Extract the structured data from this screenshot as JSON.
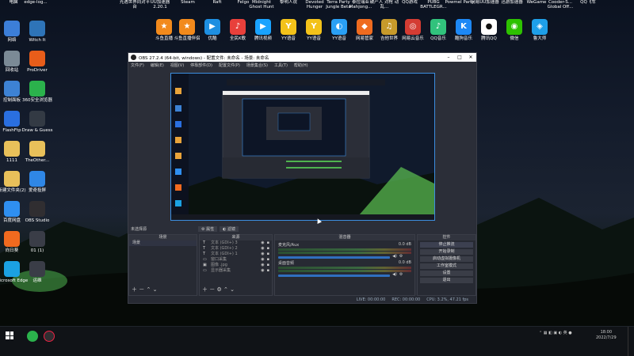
{
  "desktop": {
    "top_labels": [
      "电脑",
      "edge-log...",
      "光遇世界同对平台",
      "UU加速器 2.20.1",
      "Steam",
      "Raft",
      "Felgo",
      "Midnight Ghost Hunt",
      "黎明人说",
      "Devoted Hunger",
      "Terra Party Jungle Beta",
      "泰拉瑞亚 Mahjong...",
      "破产人 对枪 动乱...",
      "QQ游戏",
      "PUBG BATTLEGR...",
      "Powmel Party",
      "网易UU加速器",
      "迅游加速器",
      "WeGame",
      "Cooder-S... Global Off...",
      "QQ飞车"
    ],
    "app_icons": [
      {
        "label": "斗鱼直播",
        "color": "#f28a1c",
        "glyph": "★"
      },
      {
        "label": "斗鱼直播伴侣",
        "color": "#f28a1c",
        "glyph": "★"
      },
      {
        "label": "优酷",
        "color": "#1e8fe1",
        "glyph": "▶"
      },
      {
        "label": "全民K歌",
        "color": "#e8403b",
        "glyph": "♪"
      },
      {
        "label": "腾讯视频",
        "color": "#19a3ff",
        "glyph": "▶"
      },
      {
        "label": "YY语音",
        "color": "#f3c21a",
        "glyph": "Y"
      },
      {
        "label": "YY语音",
        "color": "#f3c21a",
        "glyph": "Y"
      },
      {
        "label": "YY语音",
        "color": "#2aa0f5",
        "glyph": "◐"
      },
      {
        "label": "网易管家",
        "color": "#ef6b1f",
        "glyph": "◆"
      },
      {
        "label": "吉他世界",
        "color": "#c79a2b",
        "glyph": "♫"
      },
      {
        "label": "网易云音乐",
        "color": "#d43c33",
        "glyph": "◎"
      },
      {
        "label": "QQ音乐",
        "color": "#31c27c",
        "glyph": "♪"
      },
      {
        "label": "酷狗音乐",
        "color": "#1d88f5",
        "glyph": "K"
      },
      {
        "label": "腾讯QQ",
        "color": "#ffffff",
        "glyph": "●"
      },
      {
        "label": "微信",
        "color": "#2dc100",
        "glyph": "◉"
      },
      {
        "label": "鲁大师",
        "color": "#1e9fe8",
        "glyph": "◈"
      }
    ],
    "left_icons": [
      {
        "label": "网络",
        "color": "#3c7ed8"
      },
      {
        "label": "Witch It",
        "color": "#2e74b8"
      },
      {
        "label": "回收站",
        "color": "#7b8a96"
      },
      {
        "label": "ProDriver",
        "color": "#e85d1a"
      },
      {
        "label": "控制面板",
        "color": "#3d82d4"
      },
      {
        "label": "360安全浏览器",
        "color": "#2bb24c"
      },
      {
        "label": "FlashFtp",
        "color": "#2a6fe0"
      },
      {
        "label": "Draw & Guess",
        "color": "#333a44"
      },
      {
        "label": "1111",
        "color": "#e8c05a"
      },
      {
        "label": "TheOther...",
        "color": "#e8c05a"
      },
      {
        "label": "新建文件夹(2)",
        "color": "#e8c05a"
      },
      {
        "label": "爱奇投屏",
        "color": "#2f87e6"
      },
      {
        "label": "百度网盘",
        "color": "#2f8ff0"
      },
      {
        "label": "OBS Studio",
        "color": "#302e31"
      },
      {
        "label": "向日葵",
        "color": "#f06a1f"
      },
      {
        "label": "01 (1)",
        "color": "#3a3d47"
      },
      {
        "label": "Microsoft Edge",
        "color": "#1ba1e2"
      },
      {
        "label": "运维",
        "color": "#3a3d47"
      }
    ]
  },
  "obs": {
    "title": "OBS 27.2.4 (64-bit, windows) - 配置文件: 未命名 - 场景: 未命名",
    "menu": [
      "文件(F)",
      "编辑(E)",
      "视图(V)",
      "停靠部件(D)",
      "配置文件(P)",
      "场景集合(S)",
      "工具(T)",
      "帮助(H)"
    ],
    "source_bar_label": "未选择源",
    "props_label": "属性",
    "filters_label": "滤镜",
    "scenes": {
      "header": "场景",
      "items": [
        "场景"
      ]
    },
    "sources": {
      "header": "来源",
      "items": [
        {
          "icon": "T",
          "name": "文本 (GDI+) 3"
        },
        {
          "icon": "T",
          "name": "文本 (GDI+) 2"
        },
        {
          "icon": "T",
          "name": "文本 (GDI+) 1"
        },
        {
          "icon": "▭",
          "name": "窗口采集"
        },
        {
          "icon": "▣",
          "name": "图像 .jpg"
        },
        {
          "icon": "▭",
          "name": "显示器采集"
        }
      ]
    },
    "mixer": {
      "header": "混音器",
      "tracks": [
        {
          "name": "麦克风/Aux",
          "db": "0.0 dB"
        },
        {
          "name": "桌面音频",
          "db": "0.0 dB"
        }
      ]
    },
    "controls": {
      "header": "控件",
      "buttons": [
        "停止推流",
        "开始录制",
        "启动虚拟摄像机",
        "工作室模式",
        "设置",
        "退出"
      ]
    },
    "status": {
      "live": "LIVE: 00:00:00",
      "rec": "REC: 00:00:00",
      "cpu": "CPU: 3.2%, 47.21 fps"
    }
  },
  "taskbar": {
    "time": "18:00",
    "date": "2022/7/29"
  }
}
